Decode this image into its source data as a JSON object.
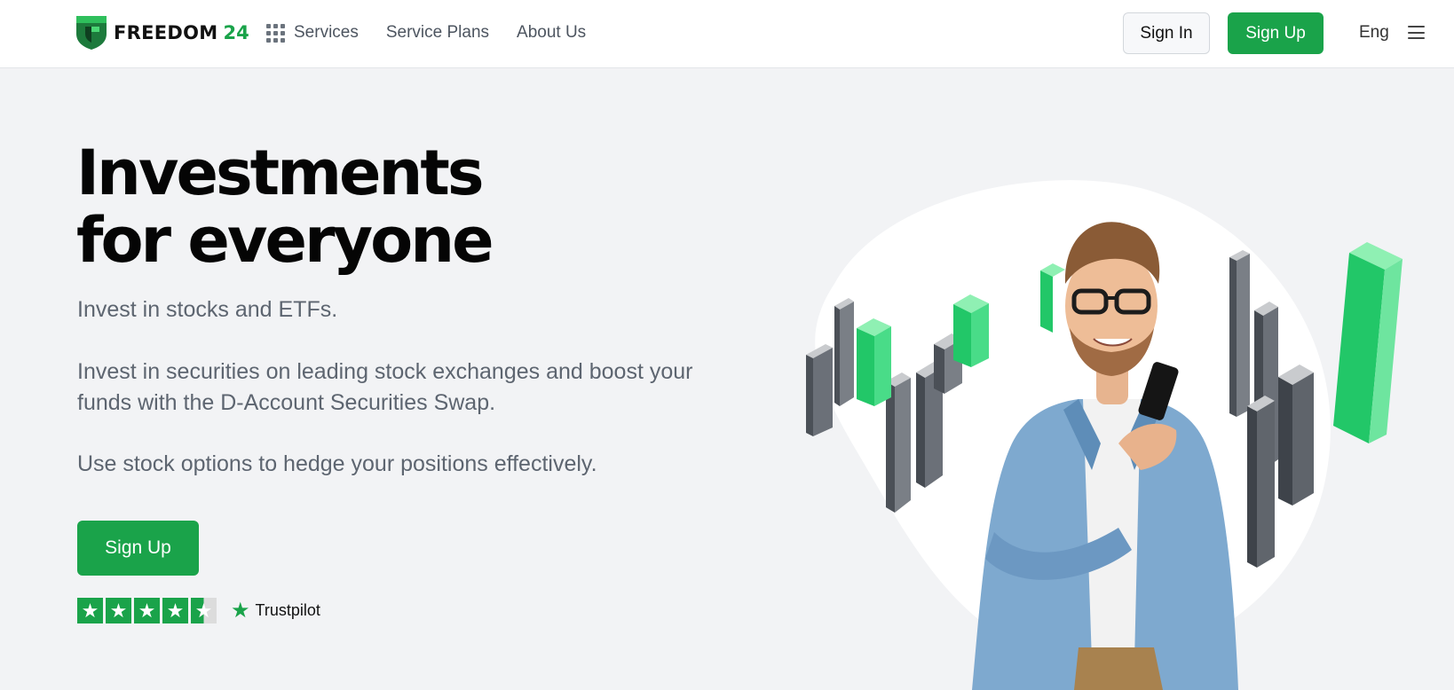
{
  "header": {
    "logo": {
      "word": "FREEDOM",
      "number": "24"
    },
    "nav": [
      {
        "label": "Services",
        "icon": "grid-icon"
      },
      {
        "label": "Service Plans"
      },
      {
        "label": "About Us"
      }
    ],
    "sign_in_label": "Sign In",
    "sign_up_label": "Sign Up",
    "language": "Eng",
    "menu_icon": "hamburger-icon"
  },
  "hero": {
    "title_line1": "Investments",
    "title_line2": "for everyone",
    "paragraph1": "Invest in stocks and ETFs.",
    "paragraph2": "Invest in securities on leading stock exchanges and boost your funds with the D-Account Securities Swap.",
    "paragraph3": "Use stock options to hedge your positions effectively.",
    "cta_label": "Sign Up",
    "rating": {
      "stars": 4.5,
      "max": 5,
      "provider": "Trustpilot"
    }
  },
  "colors": {
    "brand_green": "#1aa34a",
    "background": "#f2f3f5",
    "chart_green": "#2fd274"
  }
}
